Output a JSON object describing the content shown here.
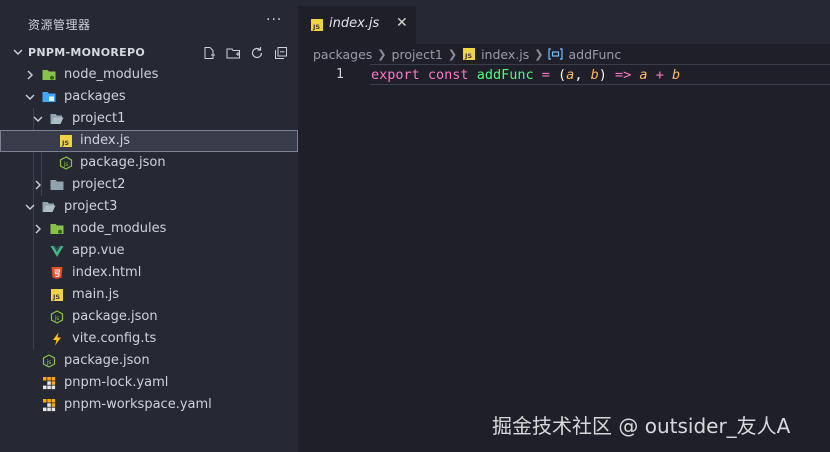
{
  "explorer": {
    "title": "资源管理器",
    "more_glyph": "···",
    "workspace_title": "PNPM-MONOREPO",
    "action_icons": [
      "new-file-icon",
      "new-folder-icon",
      "refresh-icon",
      "collapse-all-icon"
    ],
    "tree": [
      {
        "label": "node_modules",
        "kind": "folder",
        "icon": "folder-node-icon",
        "expanded": false
      },
      {
        "label": "packages",
        "kind": "folder",
        "icon": "folder-packages-icon",
        "expanded": true
      },
      {
        "label": "project1",
        "kind": "folder",
        "icon": "folder-open-icon",
        "expanded": true
      },
      {
        "label": "index.js",
        "kind": "file",
        "icon": "js-file-icon",
        "selected": true
      },
      {
        "label": "package.json",
        "kind": "file",
        "icon": "node-json-icon"
      },
      {
        "label": "project2",
        "kind": "folder",
        "icon": "folder-icon",
        "expanded": false
      },
      {
        "label": "project3",
        "kind": "folder",
        "icon": "folder-open-icon",
        "expanded": true
      },
      {
        "label": "node_modules",
        "kind": "folder",
        "icon": "folder-node-icon",
        "expanded": false
      },
      {
        "label": "app.vue",
        "kind": "file",
        "icon": "vue-icon"
      },
      {
        "label": "index.html",
        "kind": "file",
        "icon": "html5-icon"
      },
      {
        "label": "main.js",
        "kind": "file",
        "icon": "js-file-icon"
      },
      {
        "label": "package.json",
        "kind": "file",
        "icon": "node-json-icon"
      },
      {
        "label": "vite.config.ts",
        "kind": "file",
        "icon": "vite-icon"
      },
      {
        "label": "package.json",
        "kind": "file",
        "icon": "node-json-icon"
      },
      {
        "label": "pnpm-lock.yaml",
        "kind": "file",
        "icon": "pnpm-icon"
      },
      {
        "label": "pnpm-workspace.yaml",
        "kind": "file",
        "icon": "pnpm-icon"
      }
    ]
  },
  "editor": {
    "tab": {
      "label": "index.js",
      "badge": "JS",
      "close_glyph": "✕"
    },
    "breadcrumb": {
      "parts": [
        "packages",
        "project1",
        "index.js",
        "addFunc"
      ]
    },
    "lines": [
      {
        "number": "1",
        "tokens": {
          "t1": "export",
          "t2": "const",
          "t3": "addFunc",
          "t4": "=",
          "t5": "(",
          "t6": "a",
          "t7": ",",
          "t8": "b",
          "t9": ")",
          "t10": "=>",
          "t11": "a",
          "t12": "+",
          "t13": "b"
        }
      }
    ]
  },
  "watermark": "掘金技术社区 @ outsider_友人A",
  "colors": {
    "sidebar_bg": "#262834",
    "editor_bg": "#1e1f29",
    "keyword": "#ff79c6",
    "function": "#50fa7b",
    "param": "#ffb86c",
    "js_badge": "#f1d443",
    "folder": "#90a4ae",
    "node_green": "#8bc34a",
    "vue_green": "#41b883",
    "html_orange": "#e44d26",
    "vite_yellow": "#ffc517",
    "pnpm_orange": "#f9ad00"
  }
}
